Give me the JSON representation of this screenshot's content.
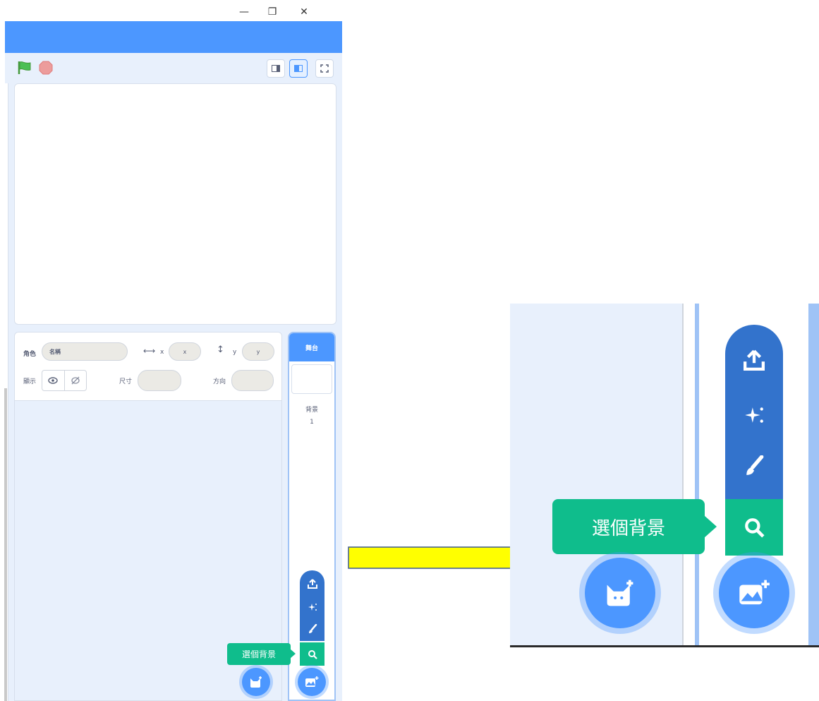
{
  "window": {
    "minimize_icon": "—",
    "restore_icon": "❐",
    "close_icon": "✕"
  },
  "sprite_info": {
    "sprite_label": "角色",
    "name_placeholder": "名稱",
    "x_label": "x",
    "x_placeholder": "x",
    "y_label": "y",
    "y_placeholder": "y",
    "show_label": "顯示",
    "size_label": "尺寸",
    "direction_label": "方向"
  },
  "stage_target": {
    "header": "舞台",
    "backdrops_label": "背景",
    "backdrop_count": "1"
  },
  "backdrop_menu": {
    "tooltip": "選個背景",
    "items": [
      "upload-icon",
      "surprise-icon",
      "paint-icon",
      "search-icon"
    ]
  },
  "colors": {
    "menubar": "#4c97ff",
    "stage_bg": "#e8f0fc",
    "menu_dark": "#3373cc",
    "tooltip_green": "#0fbd8c",
    "arrow_yellow": "#ffff00"
  }
}
